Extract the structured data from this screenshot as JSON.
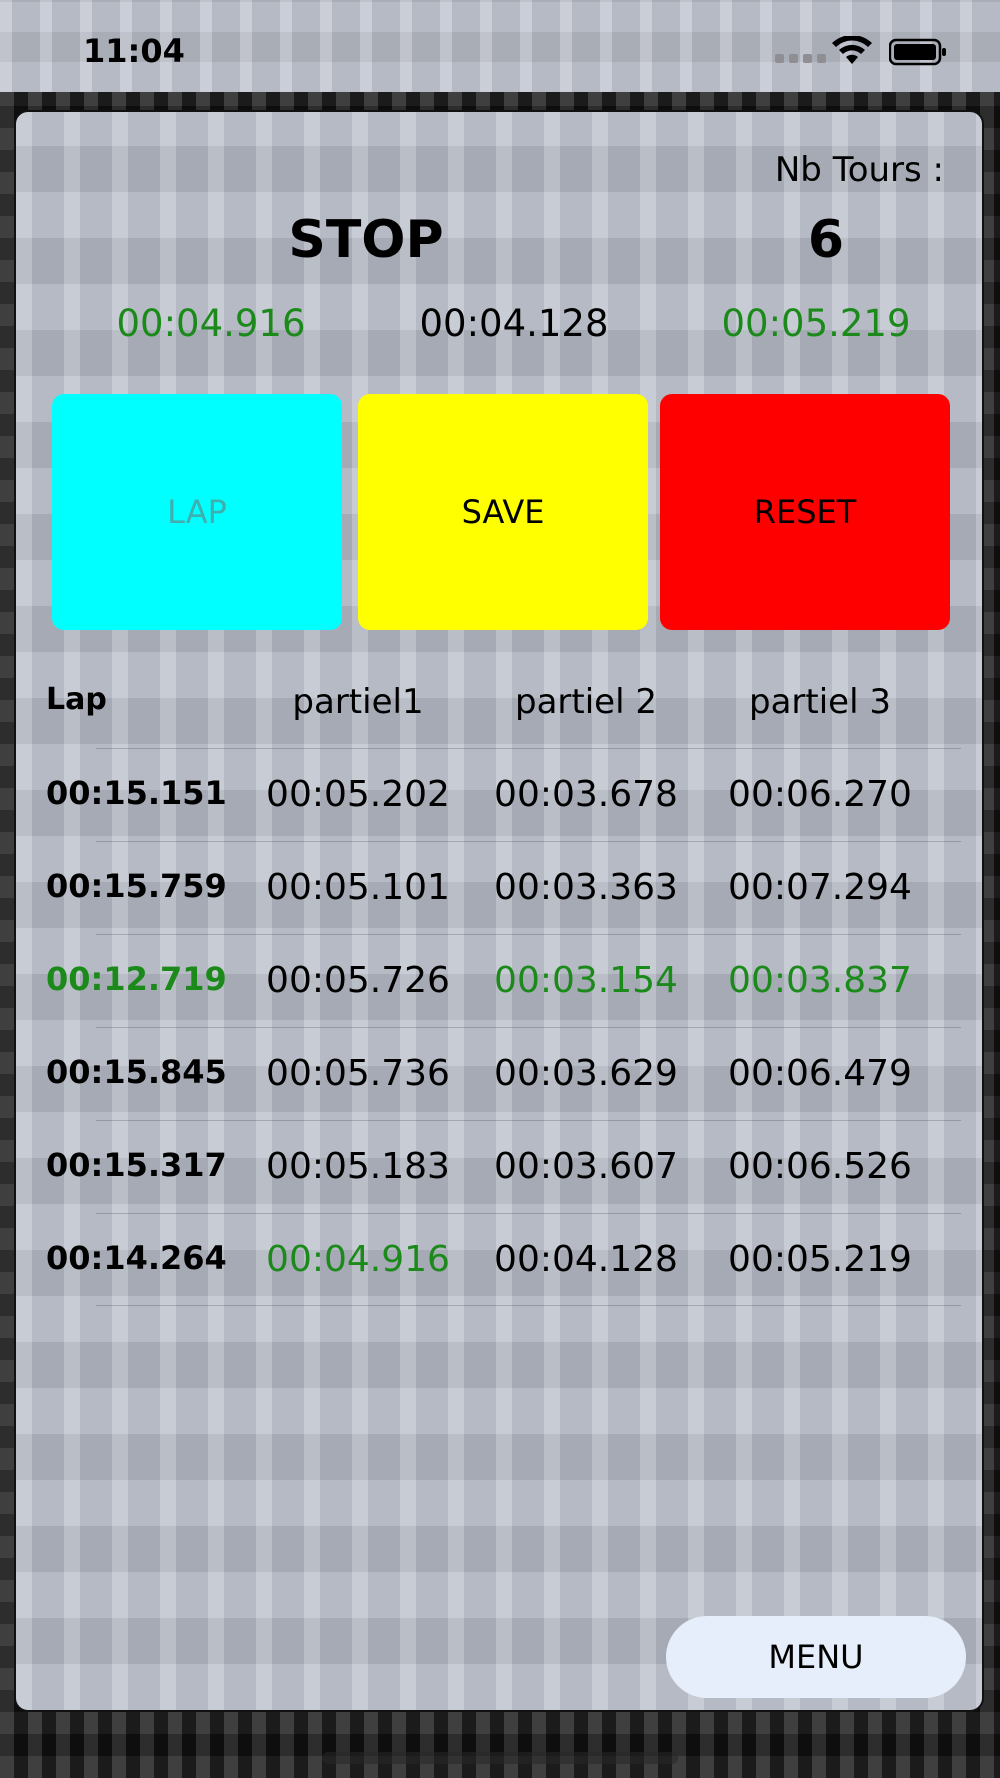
{
  "status_bar": {
    "time": "11:04"
  },
  "header": {
    "nb_tours_label": "Nb Tours :",
    "state": "STOP",
    "lap_count": "6"
  },
  "splits": [
    {
      "value": "00:04.916",
      "color": "#1b8a1b"
    },
    {
      "value": "00:04.128",
      "color": "#000000"
    },
    {
      "value": "00:05.219",
      "color": "#1b8a1b"
    }
  ],
  "buttons": {
    "lap": "LAP",
    "save": "SAVE",
    "reset": "RESET",
    "menu": "MENU"
  },
  "table": {
    "headers": [
      "Lap",
      "partiel1",
      "partiel 2",
      "partiel 3"
    ],
    "rows": [
      {
        "lap": "00:15.151",
        "p1": "00:05.202",
        "p2": "00:03.678",
        "p3": "00:06.270",
        "best": []
      },
      {
        "lap": "00:15.759",
        "p1": "00:05.101",
        "p2": "00:03.363",
        "p3": "00:07.294",
        "best": []
      },
      {
        "lap": "00:12.719",
        "p1": "00:05.726",
        "p2": "00:03.154",
        "p3": "00:03.837",
        "best": [
          "lap",
          "p2",
          "p3"
        ]
      },
      {
        "lap": "00:15.845",
        "p1": "00:05.736",
        "p2": "00:03.629",
        "p3": "00:06.479",
        "best": []
      },
      {
        "lap": "00:15.317",
        "p1": "00:05.183",
        "p2": "00:03.607",
        "p3": "00:06.526",
        "best": []
      },
      {
        "lap": "00:14.264",
        "p1": "00:04.916",
        "p2": "00:04.128",
        "p3": "00:05.219",
        "best": [
          "p1"
        ]
      }
    ]
  },
  "colors": {
    "best": "#1b8a1b",
    "lap_button": "#00ffff",
    "save_button": "#ffff00",
    "reset_button": "#ff0000",
    "menu_button": "#e6eefb"
  }
}
